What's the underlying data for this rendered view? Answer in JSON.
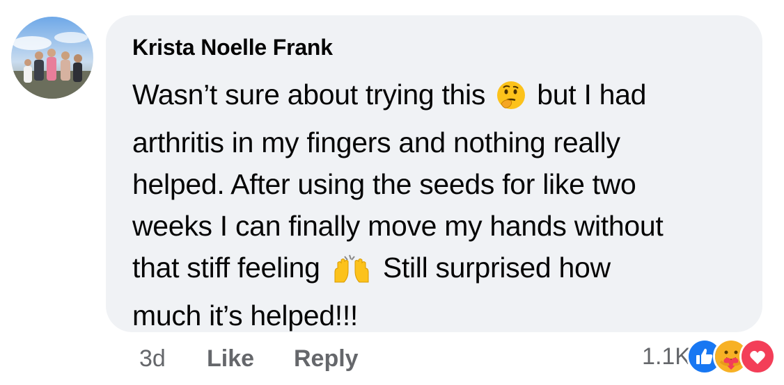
{
  "comment": {
    "author": "Krista Noelle Frank",
    "text_lines": [
      "Wasn’t sure about trying this",
      "but I had",
      "arthritis in my fingers and nothing really",
      "helped. After using the seeds for like two",
      "weeks I can finally move my hands without",
      "that stiff feeling",
      "Still surprised how",
      "much it’s helped!!!"
    ],
    "emojis": [
      "thinking-face",
      "raising-hands"
    ]
  },
  "actions": {
    "time": "3d",
    "like_label": "Like",
    "reply_label": "Reply"
  },
  "reactions": {
    "count": "1.1K",
    "icons": [
      "like-reaction",
      "care-reaction",
      "love-reaction"
    ]
  },
  "colors": {
    "bubble": "#f0f2f5",
    "text": "#050505",
    "meta": "#65676b",
    "like_blue": "#1877f2",
    "love_red": "#f33e58"
  }
}
